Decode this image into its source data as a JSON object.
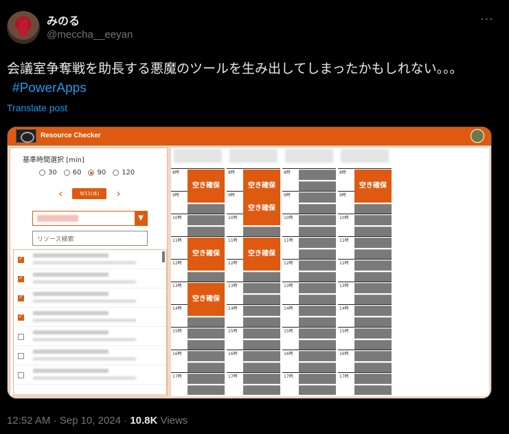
{
  "author": {
    "display_name": "みのる",
    "handle": "@meccha__eeyan",
    "more_icon": "more-icon"
  },
  "tweet": {
    "text": "会議室争奪戦を助長する悪魔のツールを生み出してしまったかもしれない。。。",
    "hashtag": "#PowerApps",
    "translate": "Translate post"
  },
  "app": {
    "title": "Resource Checker",
    "duration_label": "基準時間選択 [min]",
    "durations": [
      "30",
      "60",
      "90",
      "120"
    ],
    "selected_duration": "90",
    "date": "9/11(水)",
    "prev_icon": "chevron-left-icon",
    "next_icon": "chevron-right-icon",
    "search_placeholder": "リソース検索",
    "resources_checked": [
      true,
      true,
      true,
      true,
      false,
      false,
      false
    ],
    "hours": [
      "8時",
      "9時",
      "10時",
      "11時",
      "12時",
      "13時",
      "14時",
      "15時",
      "16時",
      "17時"
    ],
    "free_label": "空き確保",
    "columns": [
      {
        "free_hours": [
          0,
          3,
          5
        ]
      },
      {
        "free_hours": [
          0,
          1,
          3
        ]
      },
      {
        "free_hours": []
      },
      {
        "free_hours": [
          0
        ]
      }
    ]
  },
  "footer": {
    "time": "12:52 AM",
    "date": "Sep 10, 2024",
    "views": "10.8K",
    "views_label": "Views"
  }
}
